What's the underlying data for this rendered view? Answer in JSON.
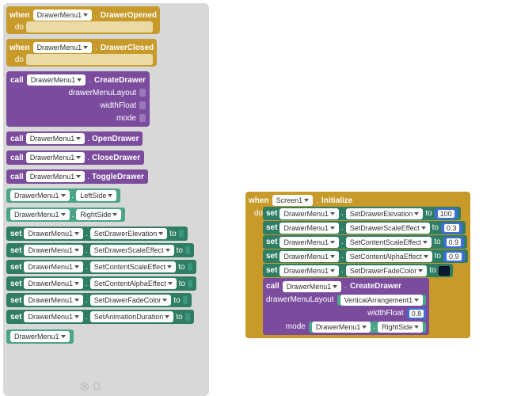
{
  "kw": {
    "when": "when",
    "do": "do",
    "call": "call",
    "set": "set",
    "to": "to",
    "dot": "."
  },
  "comp": {
    "drawer": "DrawerMenu1",
    "screen": "Screen1",
    "varr": "VerticalArrangement1"
  },
  "evt": {
    "opened": "DrawerOpened",
    "closed": "DrawerClosed",
    "init": "Initialize"
  },
  "meth": {
    "create": "CreateDrawer",
    "open": "OpenDrawer",
    "close": "CloseDrawer",
    "toggle": "ToggleDrawer"
  },
  "param": {
    "layout": "drawerMenuLayout",
    "width": "widthFloat",
    "mode": "mode"
  },
  "prop": {
    "left": "LeftSide",
    "right": "RightSide",
    "elev": "SetDrawerElevation",
    "dscale": "SetDrawerScaleEffect",
    "cscale": "SetContentScaleEffect",
    "calpha": "SetContentAlphaEffect",
    "fade": "SetDrawerFadeColor",
    "anim": "SetAnimationDuration"
  },
  "vals": {
    "elev": "100",
    "dscale": "0.3",
    "cscale": "0.9",
    "calpha": "0.9",
    "width": "0.8"
  }
}
